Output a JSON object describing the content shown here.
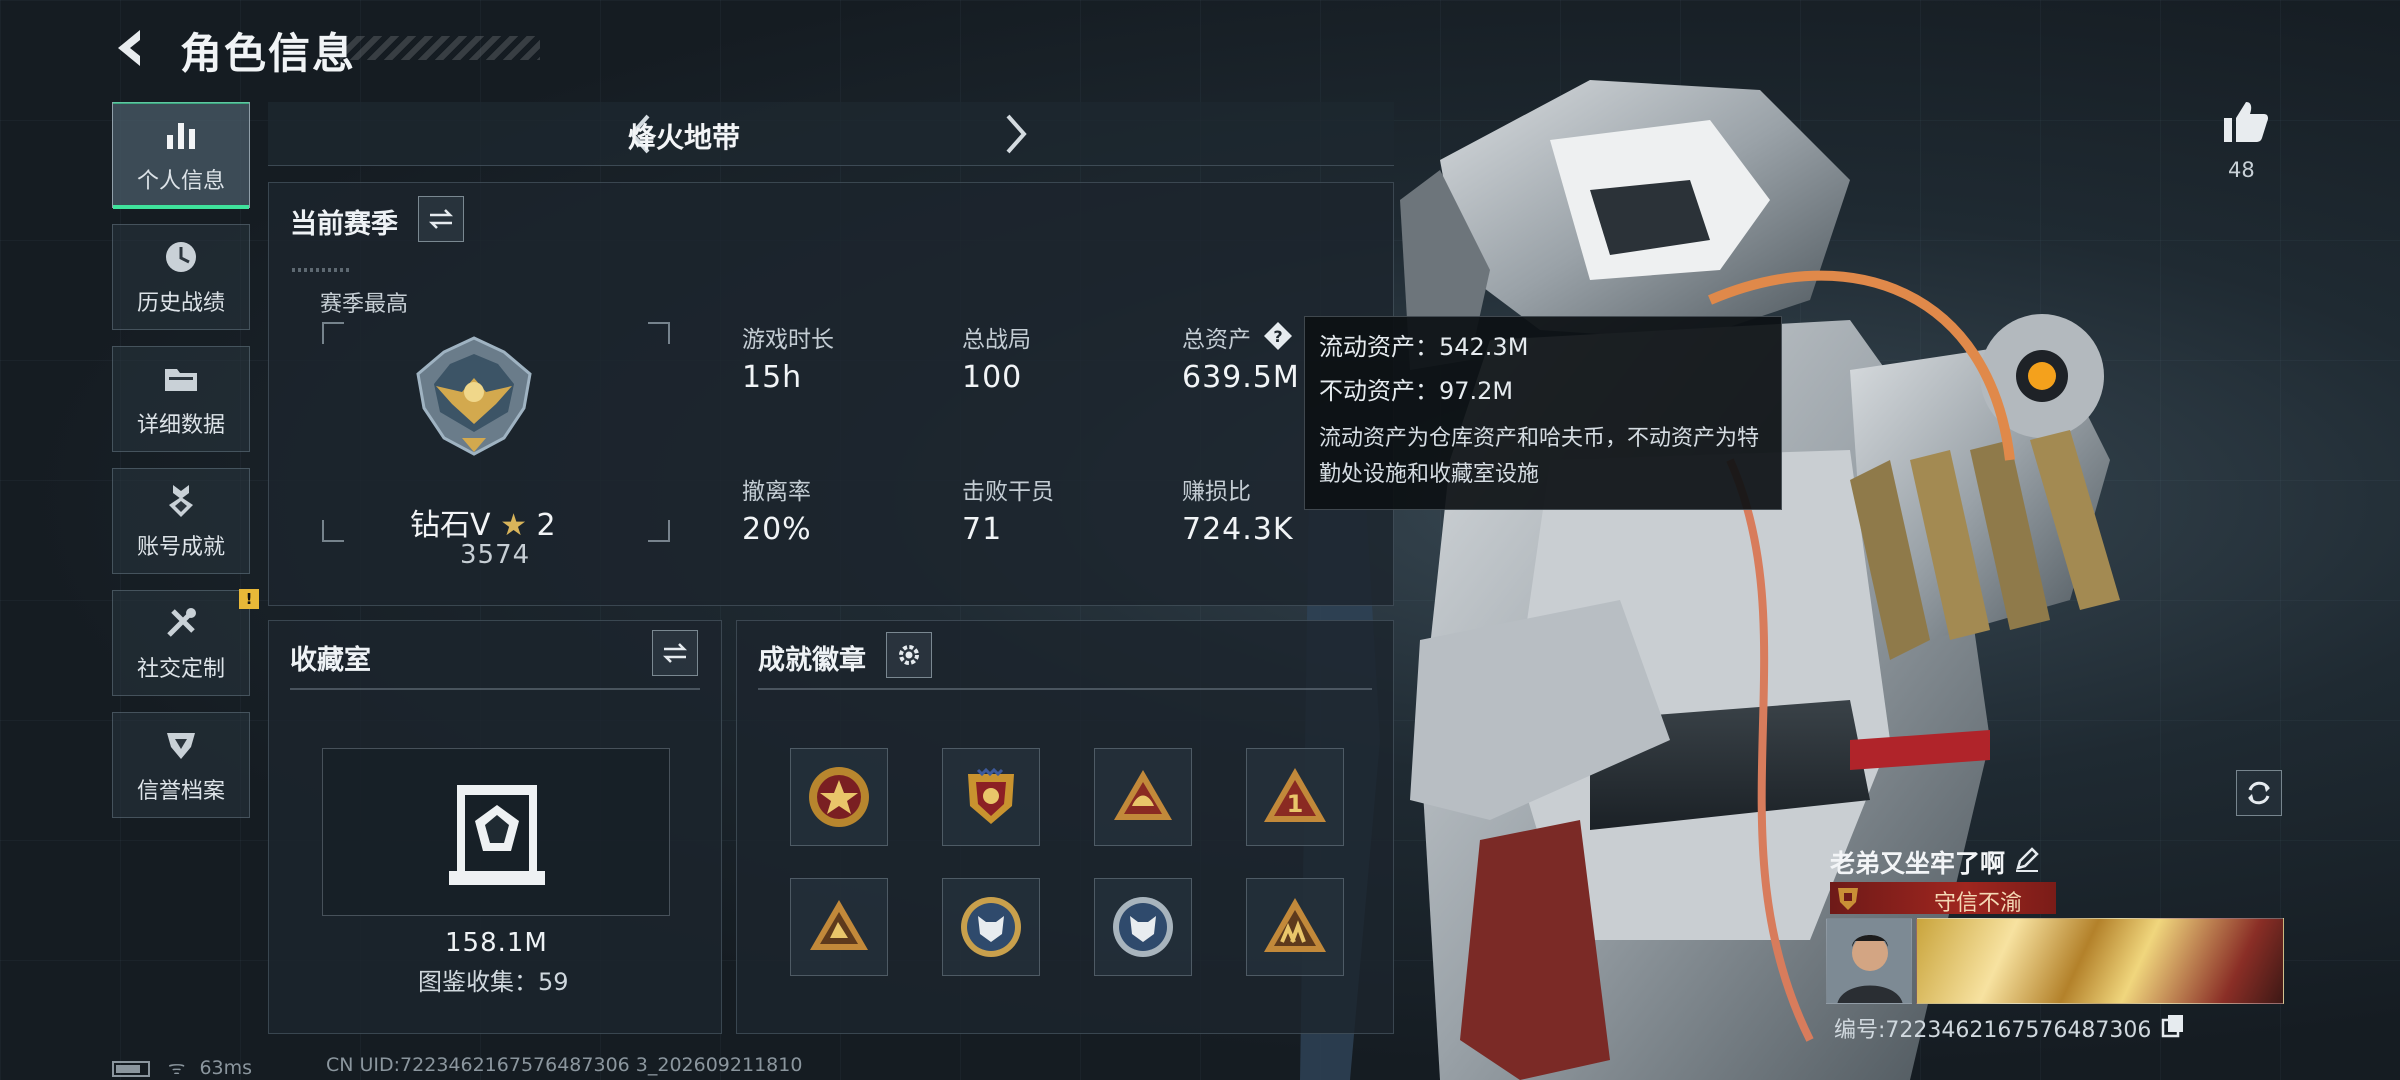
{
  "header": {
    "title": "角色信息"
  },
  "sidebar": {
    "items": [
      {
        "label": "个人信息",
        "icon": "bar-chart-icon"
      },
      {
        "label": "历史战绩",
        "icon": "clock-icon"
      },
      {
        "label": "详细数据",
        "icon": "folder-icon"
      },
      {
        "label": "账号成就",
        "icon": "medal-icon"
      },
      {
        "label": "社交定制",
        "icon": "tools-icon",
        "badge": "!"
      },
      {
        "label": "信誉档案",
        "icon": "shield-icon"
      }
    ]
  },
  "mode": {
    "title": "烽火地带"
  },
  "season": {
    "title": "当前赛季",
    "best_label": "赛季最高",
    "rank_name": "钻石V",
    "rank_stars": "2",
    "rank_score": "3574",
    "stats": [
      {
        "label": "游戏时长",
        "value": "15h"
      },
      {
        "label": "总战局",
        "value": "100"
      },
      {
        "label": "总资产",
        "value": "639.5M"
      },
      {
        "label": "撤离率",
        "value": "20%"
      },
      {
        "label": "击败干员",
        "value": "71"
      },
      {
        "label": "赚损比",
        "value": "724.3K"
      }
    ]
  },
  "tooltip": {
    "liquid": "流动资产：542.3M",
    "fixed": "不动资产：97.2M",
    "note": "流动资产为仓库资产和哈夫币，不动资产为特勤处设施和收藏室设施"
  },
  "collection": {
    "title": "收藏室",
    "value": "158.1M",
    "count": "图鉴收集：59"
  },
  "badges": {
    "title": "成就徽章"
  },
  "profile": {
    "likes": "48",
    "name": "老弟又坐牢了啊",
    "title_badge": "守信不渝",
    "id": "编号:7223462167576487306"
  },
  "status": {
    "ping": "63ms",
    "uid": "CN UID:7223462167576487306 3_202609211810"
  },
  "colors": {
    "accent": "#3fe39c",
    "warning": "#e8b838",
    "title_red": "#a0261f"
  }
}
